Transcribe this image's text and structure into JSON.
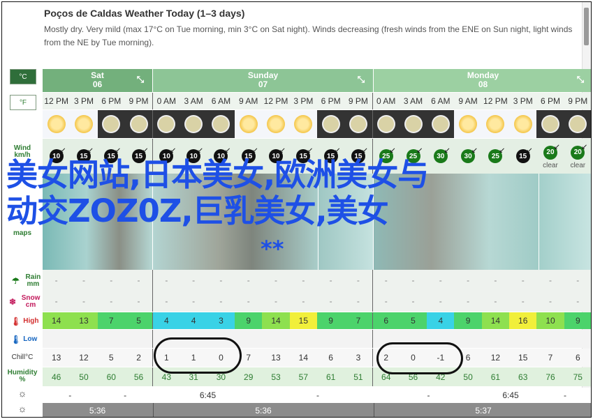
{
  "header": {
    "title": "Poços de Caldas Weather Today (1–3 days)",
    "summary": "Mostly dry. Very mild (max 17°C on Tue morning, min 3°C on Sat night). Winds decreasing (fresh winds from the ENE on Sun night, light winds from the NE by Tue morning)."
  },
  "units": {
    "celsius": "°C",
    "fahrenheit": "°F"
  },
  "row_labels": {
    "wind": "Wind km/h",
    "maps": "maps",
    "rain": "Rain mm",
    "snow": "Snow cm",
    "high": "High",
    "low": "Low",
    "chill": "Chill°C",
    "humidity": "Humidity %"
  },
  "days": [
    {
      "name": "Sat",
      "date": "06"
    },
    {
      "name": "Sunday",
      "date": "07"
    },
    {
      "name": "Monday",
      "date": "08"
    }
  ],
  "times": [
    "12 PM",
    "3 PM",
    "6 PM",
    "9 PM",
    "0 AM",
    "3 AM",
    "6 AM",
    "9 AM",
    "12 PM",
    "3 PM",
    "6 PM",
    "9 PM",
    "0 AM",
    "3 AM",
    "6 AM",
    "9 AM",
    "12 PM",
    "3 PM",
    "6 PM",
    "9 PM"
  ],
  "sky": [
    "day",
    "day",
    "night",
    "night",
    "night",
    "night",
    "night",
    "day",
    "day",
    "day",
    "night",
    "night",
    "night",
    "night",
    "night",
    "day",
    "day",
    "day",
    "night",
    "night"
  ],
  "wind": [
    "10",
    "15",
    "15",
    "15",
    "10",
    "10",
    "10",
    "15",
    "10",
    "15",
    "15",
    "15",
    "25",
    "25",
    "30",
    "30",
    "25",
    "15",
    "20",
    "20"
  ],
  "wind_extra": [
    "",
    "",
    "",
    "",
    "",
    "",
    "",
    "",
    "",
    "",
    "",
    "",
    "",
    "",
    "",
    "",
    "",
    "",
    "clear",
    "clear"
  ],
  "rain": [
    "-",
    "-",
    "-",
    "-",
    "-",
    "-",
    "-",
    "-",
    "-",
    "-",
    "-",
    "-",
    "-",
    "-",
    "-",
    "-",
    "-",
    "-",
    "-",
    "-"
  ],
  "snow": [
    "-",
    "-",
    "-",
    "-",
    "-",
    "-",
    "-",
    "-",
    "-",
    "-",
    "-",
    "-",
    "-",
    "-",
    "-",
    "-",
    "-",
    "-",
    "-",
    "-"
  ],
  "high": [
    "14",
    "13",
    "7",
    "5",
    "4",
    "4",
    "3",
    "9",
    "14",
    "15",
    "9",
    "7",
    "6",
    "5",
    "4",
    "9",
    "14",
    "16",
    "10",
    "9"
  ],
  "high_colors": [
    "#8ee04f",
    "#8ee04f",
    "#4cd36b",
    "#4cd36b",
    "#39d2e6",
    "#39d2e6",
    "#39d2e6",
    "#4cd36b",
    "#8ee04f",
    "#f1ef3a",
    "#4cd36b",
    "#4cd36b",
    "#4cd36b",
    "#4cd36b",
    "#39d2e6",
    "#4cd36b",
    "#8ee04f",
    "#f1ef3a",
    "#8ee04f",
    "#4cd36b"
  ],
  "low": [
    "",
    "",
    "",
    "",
    "",
    "",
    "",
    "",
    "",
    "",
    "",
    "",
    "",
    "",
    "",
    "",
    "",
    "",
    "",
    ""
  ],
  "chill": [
    "13",
    "12",
    "5",
    "2",
    "1",
    "1",
    "0",
    "7",
    "13",
    "14",
    "6",
    "3",
    "2",
    "0",
    "-1",
    "6",
    "12",
    "15",
    "7",
    "6"
  ],
  "humidity": [
    "46",
    "50",
    "60",
    "56",
    "43",
    "31",
    "30",
    "29",
    "53",
    "57",
    "61",
    "51",
    "64",
    "56",
    "42",
    "50",
    "61",
    "63",
    "76",
    "75"
  ],
  "sunrise": [
    {
      "text": "-"
    },
    {
      "text": "-"
    },
    {
      "text": "6:45"
    },
    {
      "text": "-"
    },
    {
      "text": "-"
    },
    {
      "text": "6:45"
    },
    {
      "text": "-"
    }
  ],
  "sunset": [
    "5:36",
    "5:36",
    "5:37"
  ],
  "overlay": {
    "line1": "美女网站,日本美女,欧洲美女与",
    "line2": "动交ZOZ0Z,巨乳美女,美女",
    "stars": "**"
  }
}
